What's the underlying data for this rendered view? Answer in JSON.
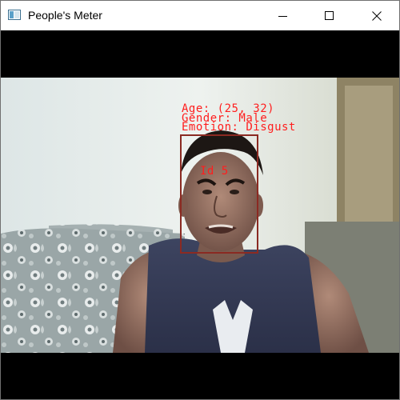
{
  "window": {
    "title": "People's Meter",
    "controls": {
      "minimize_icon": "minimize-icon",
      "maximize_icon": "maximize-icon",
      "close_icon": "close-icon"
    }
  },
  "detection": {
    "age_label": "Age: (25, 32)",
    "gender_label": "Gender: Male",
    "emotion_label": "Emotion: Disgust",
    "id_label": "Id 5",
    "label_color": "#ff1e1e",
    "box_color": "#8b2a22"
  }
}
